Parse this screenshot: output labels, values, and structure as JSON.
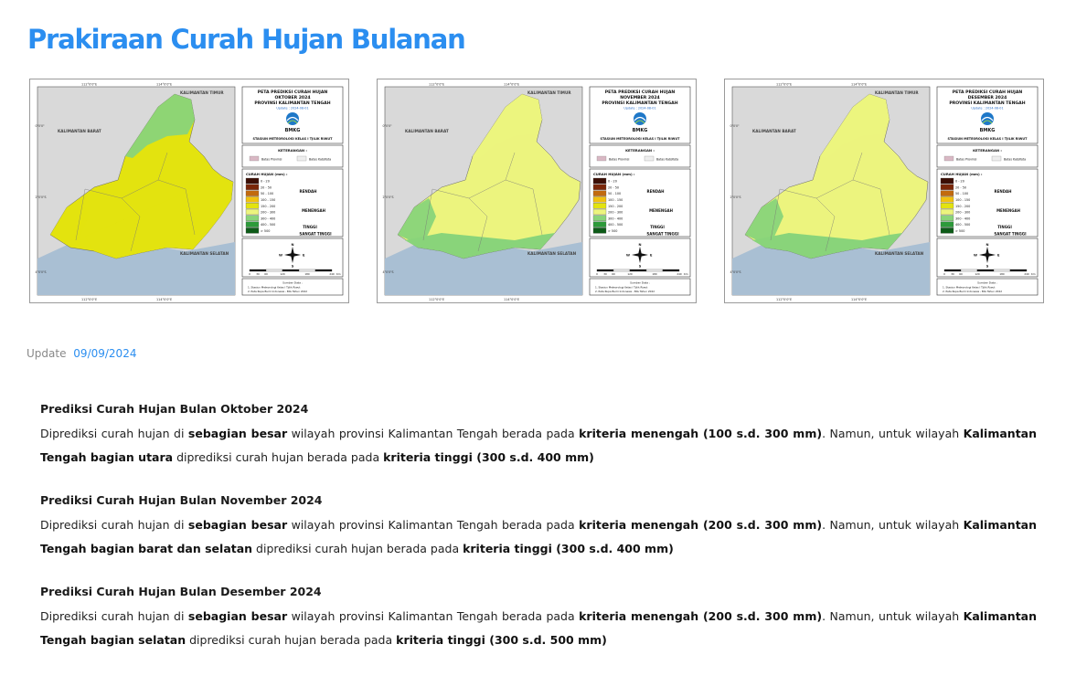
{
  "page": {
    "title": "Prakiraan Curah Hujan Bulanan"
  },
  "maps": [
    {
      "title_line1": "PETA PREDIKSI CURAH HUJAN",
      "month_line": "OKTOBER 2024",
      "province_line": "PROVINSI KALIMANTAN TENGAH",
      "update_line": "Update : 2024-08-01",
      "bmkg": "BMKG",
      "station": "STASIUN METEOROLOGI KELAS I TJILIK RIWUT",
      "label_west": "KALIMANTAN BARAT",
      "label_east": "KALIMANTAN TIMUR",
      "label_south": "KALIMANTAN SELATAN",
      "grid_top": [
        "112°0'0\"E",
        "114°0'0\"E"
      ],
      "grid_bottom": [
        "112°0'0\"E",
        "114°0'0\"E"
      ],
      "grid_left": [
        "0°0'0\"",
        "2°0'0\"S",
        "4°0'0\"S"
      ]
    },
    {
      "title_line1": "PETA PREDIKSI CURAH HUJAN",
      "month_line": "NOVEMBER 2024",
      "province_line": "PROVINSI KALIMANTAN TENGAH",
      "update_line": "Update : 2024-08-01",
      "bmkg": "BMKG",
      "station": "STASIUN METEOROLOGI KELAS I TJILIK RIWUT",
      "label_west": "KALIMANTAN BARAT",
      "label_east": "KALIMANTAN TIMUR",
      "label_south": "KALIMANTAN SELATAN",
      "grid_top": [
        "112°0'0\"E",
        "114°0'0\"E"
      ],
      "grid_bottom": [
        "112°0'0\"E",
        "114°0'0\"E"
      ],
      "grid_left": [
        "0°0'0\"",
        "2°0'0\"S",
        "4°0'0\"S"
      ]
    },
    {
      "title_line1": "PETA PREDIKSI CURAH HUJAN",
      "month_line": "DESEMBER 2024",
      "province_line": "PROVINSI KALIMANTAN TENGAH",
      "update_line": "Update : 2024-08-01",
      "bmkg": "BMKG",
      "station": "STASIUN METEOROLOGI KELAS I TJILIK RIWUT",
      "label_west": "KALIMANTAN BARAT",
      "label_east": "KALIMANTAN TIMUR",
      "label_south": "KALIMANTAN SELATAN",
      "grid_top": [
        "112°0'0\"E",
        "114°0'0\"E"
      ],
      "grid_bottom": [
        "112°0'0\"E",
        "114°0'0\"E"
      ],
      "grid_left": [
        "0°0'0\"",
        "2°0'0\"S",
        "4°0'0\"S"
      ]
    }
  ],
  "legend": {
    "keterangan": "KETERANGAN :",
    "batas_provinsi": "Batas Provinsi",
    "batas_kabkota": "Batas Kab/Kota",
    "curah_hujan_title": "CURAH HUJAN (mm) :",
    "classes": [
      {
        "range": "0 - 20",
        "color": "#3b0d04"
      },
      {
        "range": "20 - 50",
        "color": "#7a2608"
      },
      {
        "range": "50 - 100",
        "color": "#c26a0e"
      },
      {
        "range": "100 - 150",
        "color": "#f2c10f"
      },
      {
        "range": "150 - 200",
        "color": "#e3e30f"
      },
      {
        "range": "200 - 300",
        "color": "#ecf47e"
      },
      {
        "range": "300 - 400",
        "color": "#89d47a"
      },
      {
        "range": "400 - 500",
        "color": "#2d9a3a"
      },
      {
        "range": "> 500",
        "color": "#0d5a18"
      }
    ],
    "criteria": {
      "rendah": "RENDAH",
      "menengah": "MENENGAH",
      "tinggi": "TINGGI",
      "sangat_tinggi": "SANGAT TINGGI"
    },
    "north": "N",
    "south": "S",
    "west": "W",
    "east": "E",
    "scale_ticks": [
      "0",
      "30",
      "60",
      "120",
      "180",
      "240"
    ],
    "scale_unit": "Km",
    "sumber": "Sumber Data :",
    "source1": "1. Stasiun Meteorologi Kelas I Tjilik Riwut",
    "source2": "2. Peta Rupa Bumi Indonesia - BIG Tahun 2022"
  },
  "update": {
    "label": "Update",
    "date": "09/09/2024"
  },
  "forecasts": [
    {
      "title": "Prediksi Curah Hujan Bulan Oktober 2024",
      "s1": "Diprediksi curah hujan di ",
      "b1": "sebagian besar",
      "s2": " wilayah provinsi Kalimantan Tengah berada pada ",
      "b2": "kriteria menengah (100 s.d. 300 mm)",
      "s3": ". Namun, untuk wilayah ",
      "b3": "Kalimantan Tengah bagian utara",
      "s4": " diprediksi curah hujan berada pada ",
      "b4": "kriteria tinggi (300 s.d. 400 mm)"
    },
    {
      "title": "Prediksi Curah Hujan Bulan November 2024",
      "s1": "Diprediksi curah hujan di ",
      "b1": "sebagian besar",
      "s2": " wilayah provinsi Kalimantan Tengah berada pada ",
      "b2": "kriteria menengah (200 s.d. 300 mm)",
      "s3": ". Namun, untuk wilayah ",
      "b3": "Kalimantan Tengah bagian barat dan selatan",
      "s4": " diprediksi curah hujan berada pada ",
      "b4": "kriteria tinggi (300 s.d. 400 mm)"
    },
    {
      "title": "Prediksi Curah Hujan Bulan Desember 2024",
      "s1": "Diprediksi curah hujan di ",
      "b1": "sebagian besar",
      "s2": " wilayah provinsi Kalimantan Tengah berada pada ",
      "b2": "kriteria menengah (200 s.d. 300 mm)",
      "s3": ". Namun, untuk wilayah ",
      "b3": "Kalimantan Tengah bagian selatan",
      "s4": " diprediksi curah hujan berada pada ",
      "b4": "kriteria tinggi (300 s.d. 500 mm)"
    }
  ]
}
